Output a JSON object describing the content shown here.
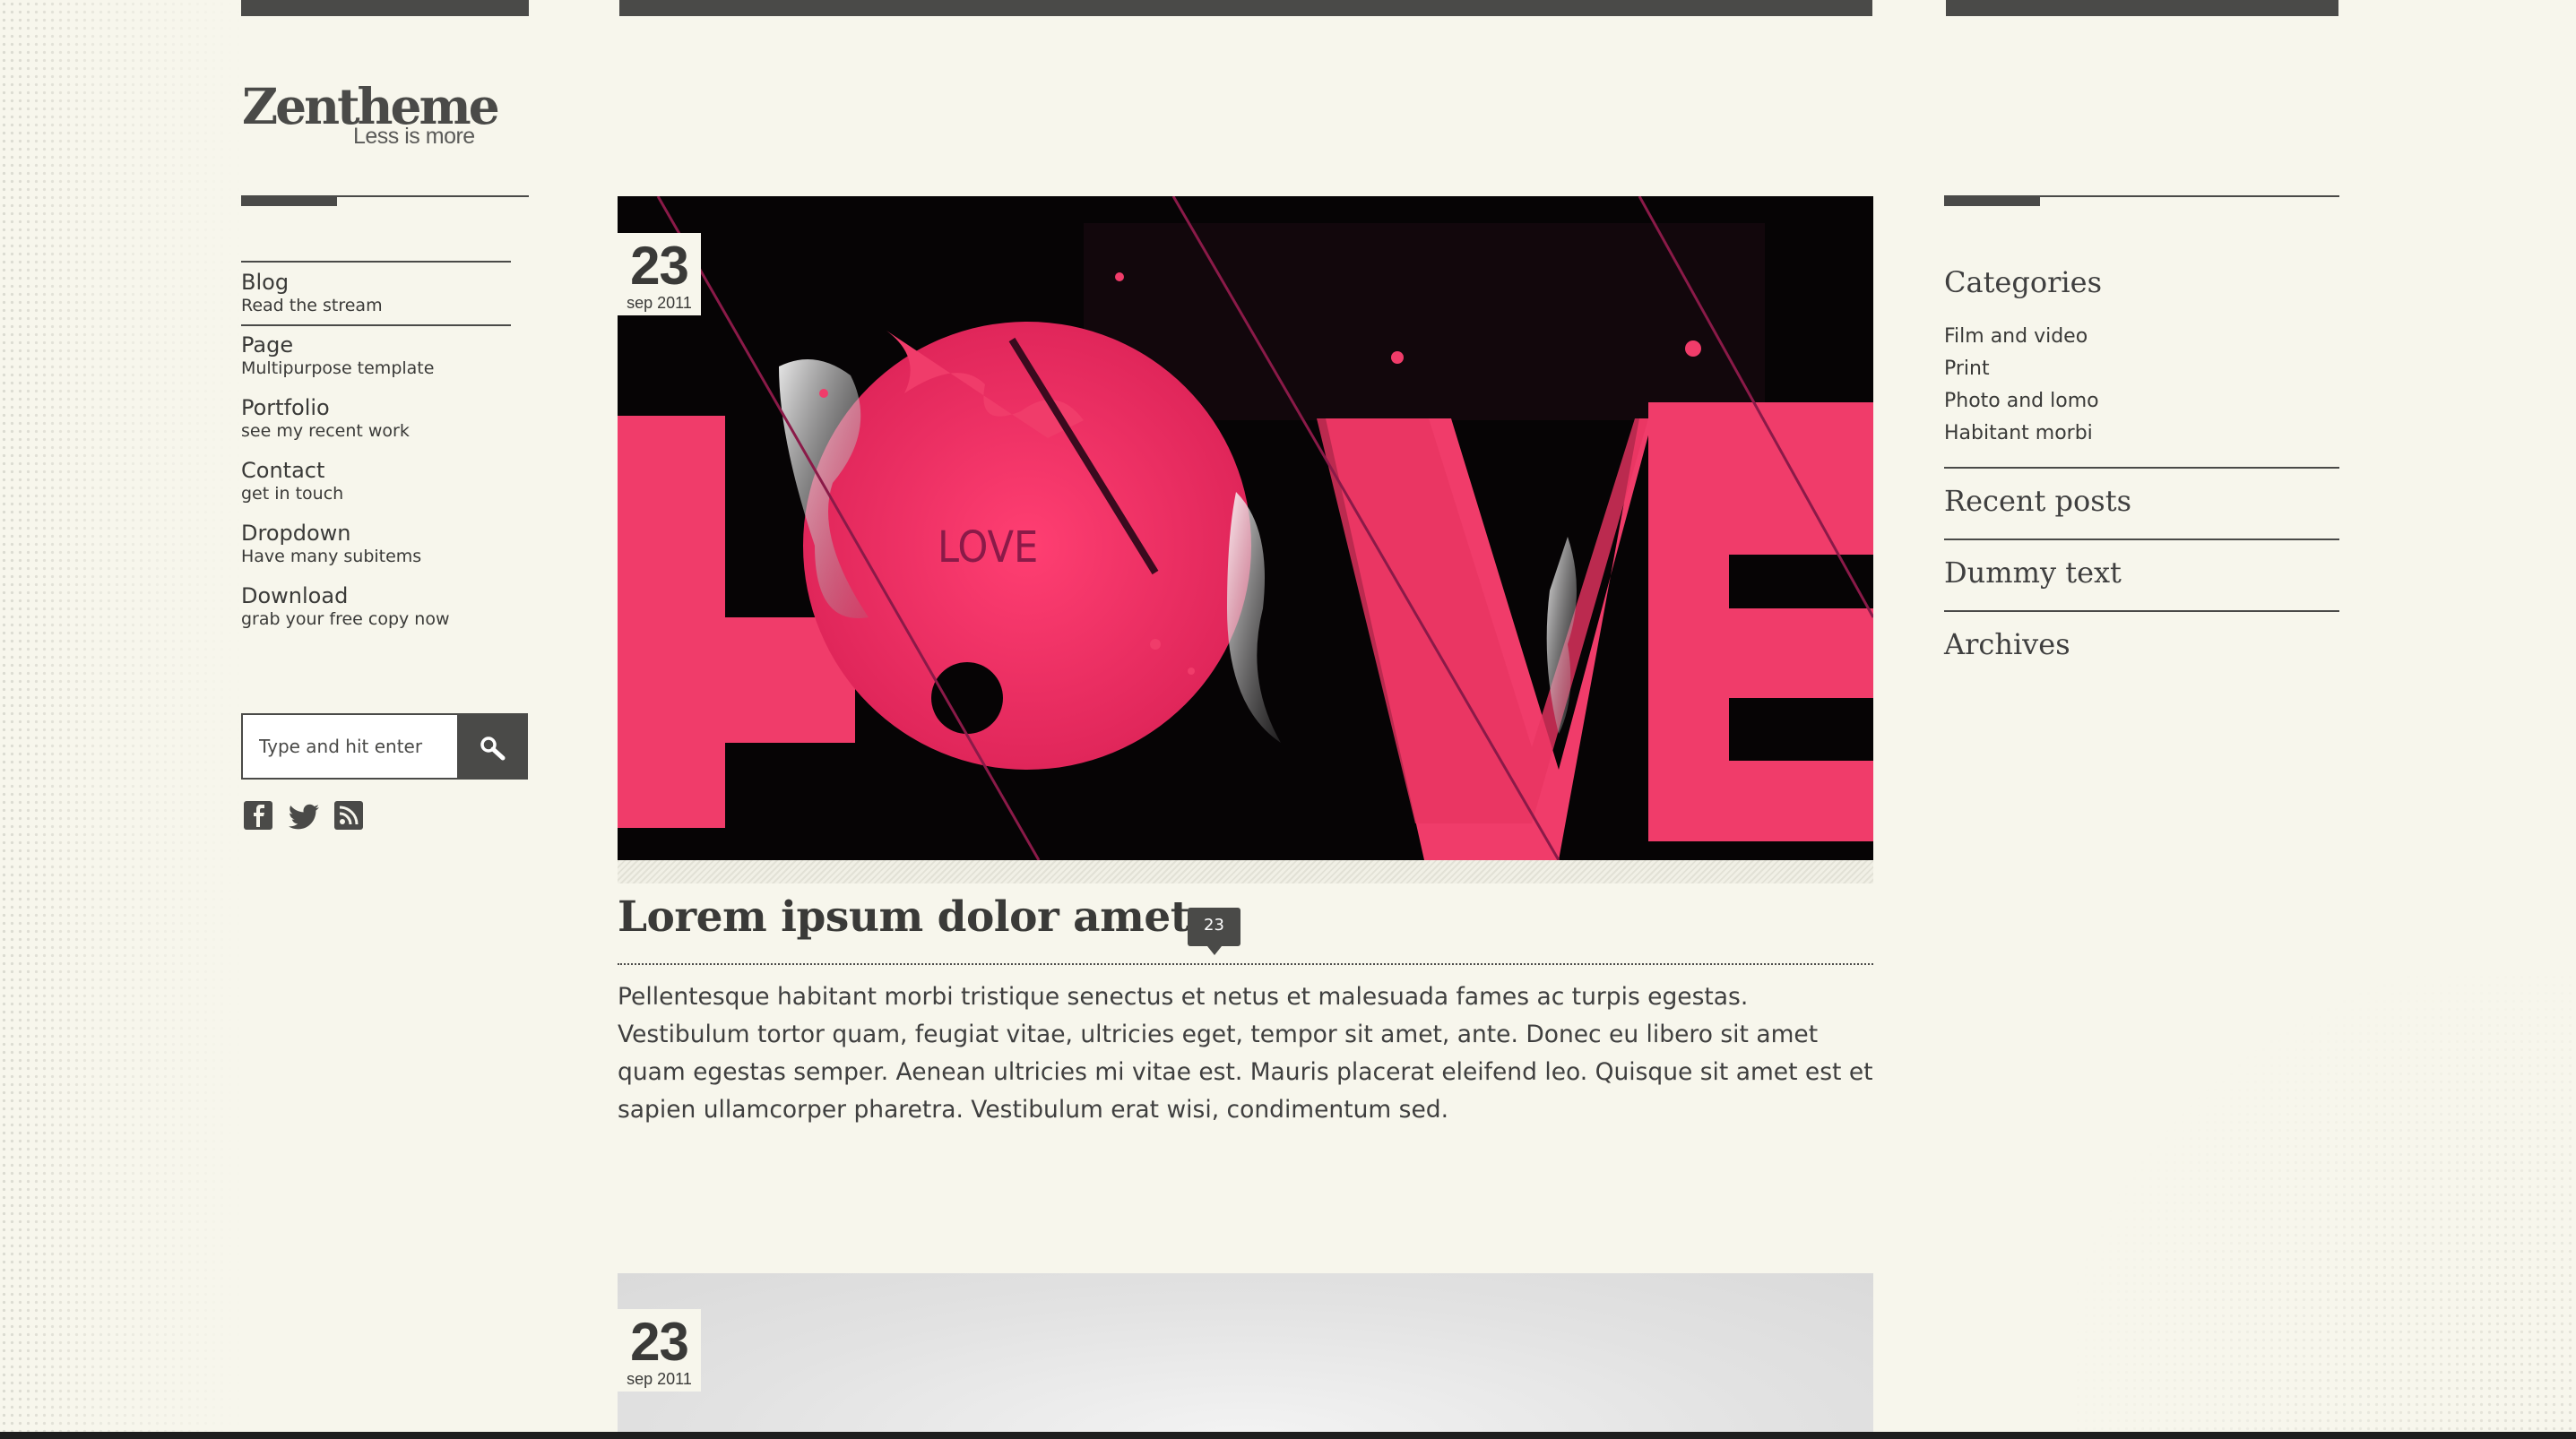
{
  "site": {
    "title": "Zentheme",
    "tagline": "Less is more"
  },
  "nav": {
    "items": [
      {
        "label": "Blog",
        "sub": "Read the stream"
      },
      {
        "label": "Page",
        "sub": "Multipurpose template"
      },
      {
        "label": "Portfolio",
        "sub": "see my recent work"
      },
      {
        "label": "Contact",
        "sub": "get in touch"
      },
      {
        "label": "Dropdown",
        "sub": "Have many subitems"
      },
      {
        "label": "Download",
        "sub": "grab your free copy now"
      }
    ]
  },
  "search": {
    "placeholder": "Type and hit enter",
    "button_icon": "search-icon"
  },
  "social": [
    "facebook-icon",
    "twitter-icon",
    "rss-icon"
  ],
  "posts": [
    {
      "day": "23",
      "month_year": "sep 2011",
      "image_text": "LOVE",
      "title": "Lorem ipsum dolor amet",
      "comments": "23",
      "excerpt": "Pellentesque habitant morbi tristique senectus et netus et malesuada fames ac turpis egestas. Vestibulum tortor quam, feugiat vitae, ultricies eget, tempor sit amet, ante. Donec eu libero sit amet quam egestas semper. Aenean ultricies mi vitae est. Mauris placerat eleifend leo. Quisque sit amet est et sapien ullamcorper pharetra. Vestibulum erat wisi, condimentum sed."
    },
    {
      "day": "23",
      "month_year": "sep 2011"
    }
  ],
  "sidebar": {
    "categories_title": "Categories",
    "categories": [
      "Film and video",
      "Print",
      "Photo and lomo",
      "Habitant morbi"
    ],
    "widgets": [
      "Recent posts",
      "Dummy text",
      "Archives"
    ]
  },
  "colors": {
    "background": "#f7f6ec",
    "dark": "#4a4a48",
    "accent_pink": "#f03c6a"
  }
}
